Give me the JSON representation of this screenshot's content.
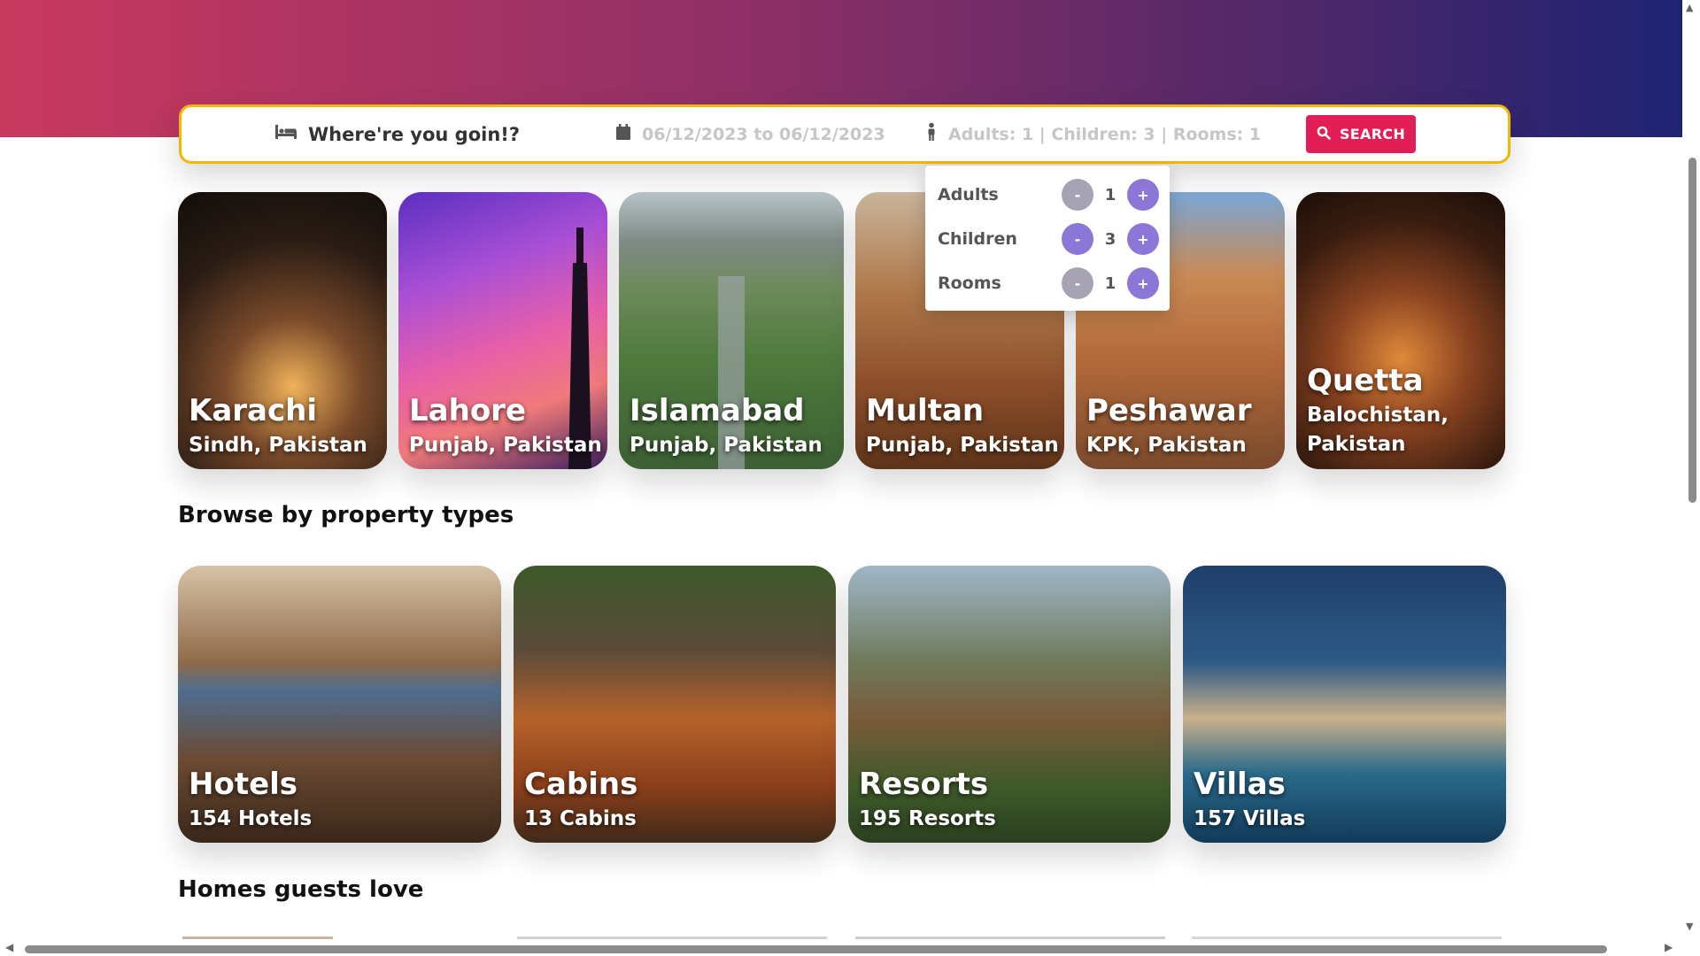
{
  "search": {
    "destination_placeholder": "Where're you goin!?",
    "dates": "06/12/2023 to 06/12/2023",
    "guests_summary": "Adults: 1 | Children: 3 | Rooms: 1",
    "search_label": "SEARCH"
  },
  "guest_options": [
    {
      "label": "Adults",
      "value": "1",
      "minus": "-",
      "plus": "+"
    },
    {
      "label": "Children",
      "value": "3",
      "minus": "-",
      "plus": "+"
    },
    {
      "label": "Rooms",
      "value": "1",
      "minus": "-",
      "plus": "+"
    }
  ],
  "cities": [
    {
      "name": "Karachi",
      "region": "Sindh, Pakistan"
    },
    {
      "name": "Lahore",
      "region": "Punjab, Pakistan"
    },
    {
      "name": "Islamabad",
      "region": "Punjab, Pakistan"
    },
    {
      "name": "Multan",
      "region": "Punjab, Pakistan"
    },
    {
      "name": "Peshawar",
      "region": "KPK, Pakistan"
    },
    {
      "name": "Quetta",
      "region": "Balochistan,",
      "region_line2": "Pakistan"
    }
  ],
  "sections": {
    "property_types": "Browse by property types",
    "homes": "Homes guests love"
  },
  "property_types": [
    {
      "name": "Hotels",
      "count": "154 Hotels"
    },
    {
      "name": "Cabins",
      "count": "13 Cabins"
    },
    {
      "name": "Resorts",
      "count": "195 Resorts"
    },
    {
      "name": "Villas",
      "count": "157 Villas"
    }
  ],
  "colors": {
    "accent": "#e11e55",
    "search_border": "#f3b700",
    "stepper": "#8c76d8",
    "hero_start": "#c8385f",
    "hero_end": "#1e2373"
  },
  "icons": {
    "destination": "bed-icon",
    "dates": "calendar-icon",
    "guests": "person-icon",
    "search": "search-icon"
  }
}
